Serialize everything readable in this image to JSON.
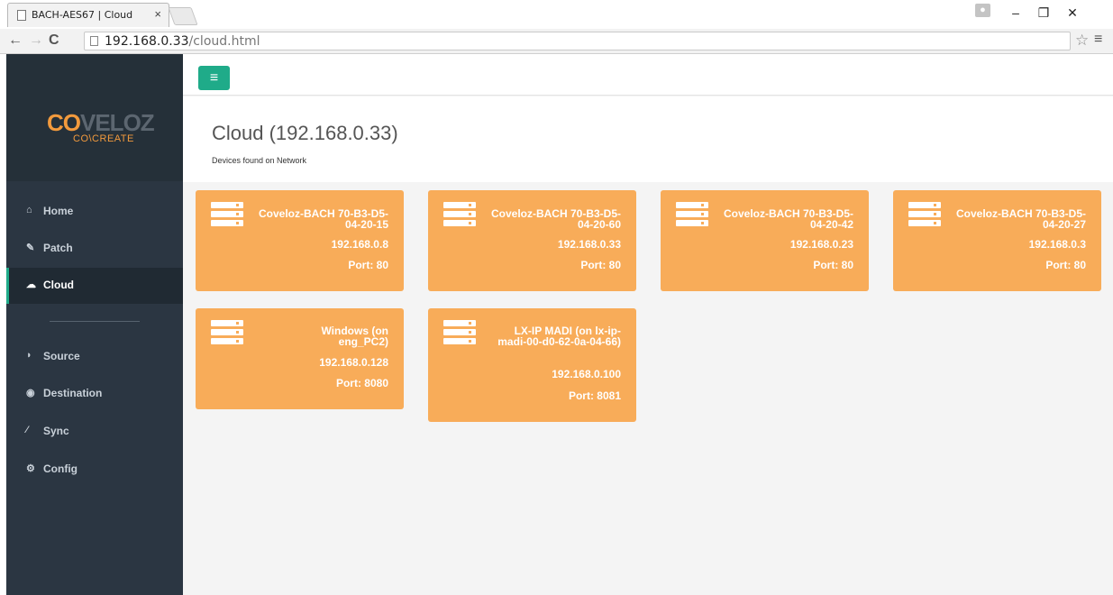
{
  "browser": {
    "tab_title": "BACH-AES67 | Cloud",
    "tab_close": "×",
    "url_host": "192.168.0.33",
    "url_path": "/cloud.html"
  },
  "sidebar": {
    "logo_co": "CO",
    "logo_veloz": "VELOZ",
    "logo_sub": "CO\\CREATE",
    "items": [
      {
        "label": "Home",
        "icon": "home-icon"
      },
      {
        "label": "Patch",
        "icon": "edit-icon"
      },
      {
        "label": "Cloud",
        "icon": "cloud-icon"
      },
      {
        "label": "Source",
        "icon": "source-icon"
      },
      {
        "label": "Destination",
        "icon": "destination-icon"
      },
      {
        "label": "Sync",
        "icon": "sync-icon"
      },
      {
        "label": "Config",
        "icon": "gears-icon"
      }
    ],
    "active_item": "Cloud"
  },
  "page": {
    "title": "Cloud (192.168.0.33)",
    "subtitle": "Devices found on Network"
  },
  "devices": [
    {
      "name": "Coveloz-BACH 70-B3-D5-04-20-15",
      "ip": "192.168.0.8",
      "port": "Port: 80"
    },
    {
      "name": "Coveloz-BACH 70-B3-D5-04-20-60",
      "ip": "192.168.0.33",
      "port": "Port: 80"
    },
    {
      "name": "Coveloz-BACH 70-B3-D5-04-20-42",
      "ip": "192.168.0.23",
      "port": "Port: 80"
    },
    {
      "name": "Coveloz-BACH 70-B3-D5-04-20-27",
      "ip": "192.168.0.3",
      "port": "Port: 80"
    },
    {
      "name": "Windows (on eng_PC2)",
      "ip": "192.168.0.128",
      "port": "Port: 8080"
    },
    {
      "name": "LX-IP MADI (on lx-ip-madi-00-d0-62-0a-04-66)",
      "ip": "192.168.0.100",
      "port": "Port: 8081"
    }
  ],
  "colors": {
    "accent": "#1fab89",
    "card": "#f8ac59",
    "sidebar": "#2b3642"
  }
}
